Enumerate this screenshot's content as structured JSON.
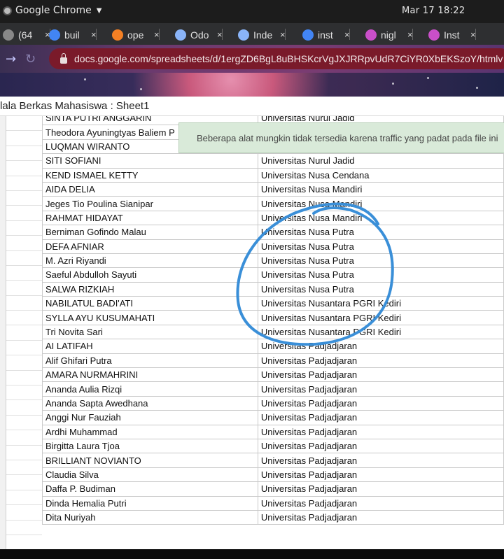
{
  "topbar": {
    "app_name": "Google Chrome",
    "clock": "Mar 17  18:22"
  },
  "tabs": [
    {
      "label": "(64",
      "icon": "chrome-icon",
      "color": "#888888"
    },
    {
      "label": "buil",
      "icon": "google-icon",
      "color": "#4285f4"
    },
    {
      "label": "ope",
      "icon": "stackoverflow-icon",
      "color": "#f48024"
    },
    {
      "label": "Odo",
      "icon": "globe-icon",
      "color": "#8ab4f8"
    },
    {
      "label": "Inde",
      "icon": "globe-icon",
      "color": "#8ab4f8"
    },
    {
      "label": "inst",
      "icon": "google-icon",
      "color": "#4285f4"
    },
    {
      "label": "nigl",
      "icon": "circle-icon",
      "color": "#c94fc9"
    },
    {
      "label": "Inst",
      "icon": "circle-icon",
      "color": "#c94fc9"
    }
  ],
  "address": {
    "url": "docs.google.com/spreadsheets/d/1ergZD6BgL8uBHSKcrVgJXJRRpvUdR7CiYR0XbEKSzoY/htmlv"
  },
  "sheet": {
    "title": "lala Berkas Mahasiswa : Sheet1"
  },
  "toast": {
    "message": "Beberapa alat mungkin tidak tersedia karena traffic yang padat pada file ini"
  },
  "rows": [
    {
      "name": "SINTA PUTRI ANGGARIN",
      "univ": "Universitas Nurul Jadid"
    },
    {
      "name": "Theodora Ayuningtyas Baliem P",
      "univ": ""
    },
    {
      "name": "LUQMAN WIRANTO",
      "univ": ""
    },
    {
      "name": "SITI SOFIANI",
      "univ": "Universitas Nurul Jadid"
    },
    {
      "name": "KEND ISMAEL KETTY",
      "univ": "Universitas Nusa Cendana"
    },
    {
      "name": "AIDA DELIA",
      "univ": "Universitas Nusa Mandiri"
    },
    {
      "name": "Jeges Tio Poulina Sianipar",
      "univ": "Universitas Nusa Mandiri"
    },
    {
      "name": "RAHMAT HIDAYAT",
      "univ": "Universitas Nusa Mandiri"
    },
    {
      "name": "Berniman Gofindo Malau",
      "univ": "Universitas Nusa Putra"
    },
    {
      "name": "DEFA AFNIAR",
      "univ": "Universitas Nusa Putra"
    },
    {
      "name": "M. Azri Riyandi",
      "univ": "Universitas Nusa Putra"
    },
    {
      "name": "Saeful Abdulloh Sayuti",
      "univ": "Universitas Nusa Putra"
    },
    {
      "name": "SALWA RIZKIAH",
      "univ": "Universitas Nusa Putra"
    },
    {
      "name": "NABILATUL BADI'ATI",
      "univ": "Universitas Nusantara PGRI Kediri"
    },
    {
      "name": "SYLLA AYU KUSUMAHATI",
      "univ": "Universitas Nusantara PGRI Kediri"
    },
    {
      "name": "Tri Novita Sari",
      "univ": "Universitas Nusantara PGRI Kediri"
    },
    {
      "name": "AI LATIFAH",
      "univ": "Universitas Padjadjaran"
    },
    {
      "name": "Alif Ghifari Putra",
      "univ": "Universitas Padjadjaran"
    },
    {
      "name": "AMARA NURMAHRINI",
      "univ": "Universitas Padjadjaran"
    },
    {
      "name": "Ananda Aulia Rizqi",
      "univ": "Universitas Padjadjaran"
    },
    {
      "name": "Ananda Sapta Awedhana",
      "univ": "Universitas Padjadjaran"
    },
    {
      "name": "Anggi Nur Fauziah",
      "univ": "Universitas Padjadjaran"
    },
    {
      "name": "Ardhi Muhammad",
      "univ": "Universitas Padjadjaran"
    },
    {
      "name": "Birgitta Laura Tjoa",
      "univ": "Universitas Padjadjaran"
    },
    {
      "name": "BRILLIANT NOVIANTO",
      "univ": "Universitas Padjadjaran"
    },
    {
      "name": "Claudia Silva",
      "univ": "Universitas Padjadjaran"
    },
    {
      "name": "Daffa P. Budiman",
      "univ": "Universitas Padjadjaran"
    },
    {
      "name": "Dinda Hemalia Putri",
      "univ": "Universitas Padjadjaran"
    },
    {
      "name": "Dita Nuriyah",
      "univ": "Universitas Padjadjaran"
    }
  ],
  "annotation": {
    "color": "#3a8fd8"
  }
}
